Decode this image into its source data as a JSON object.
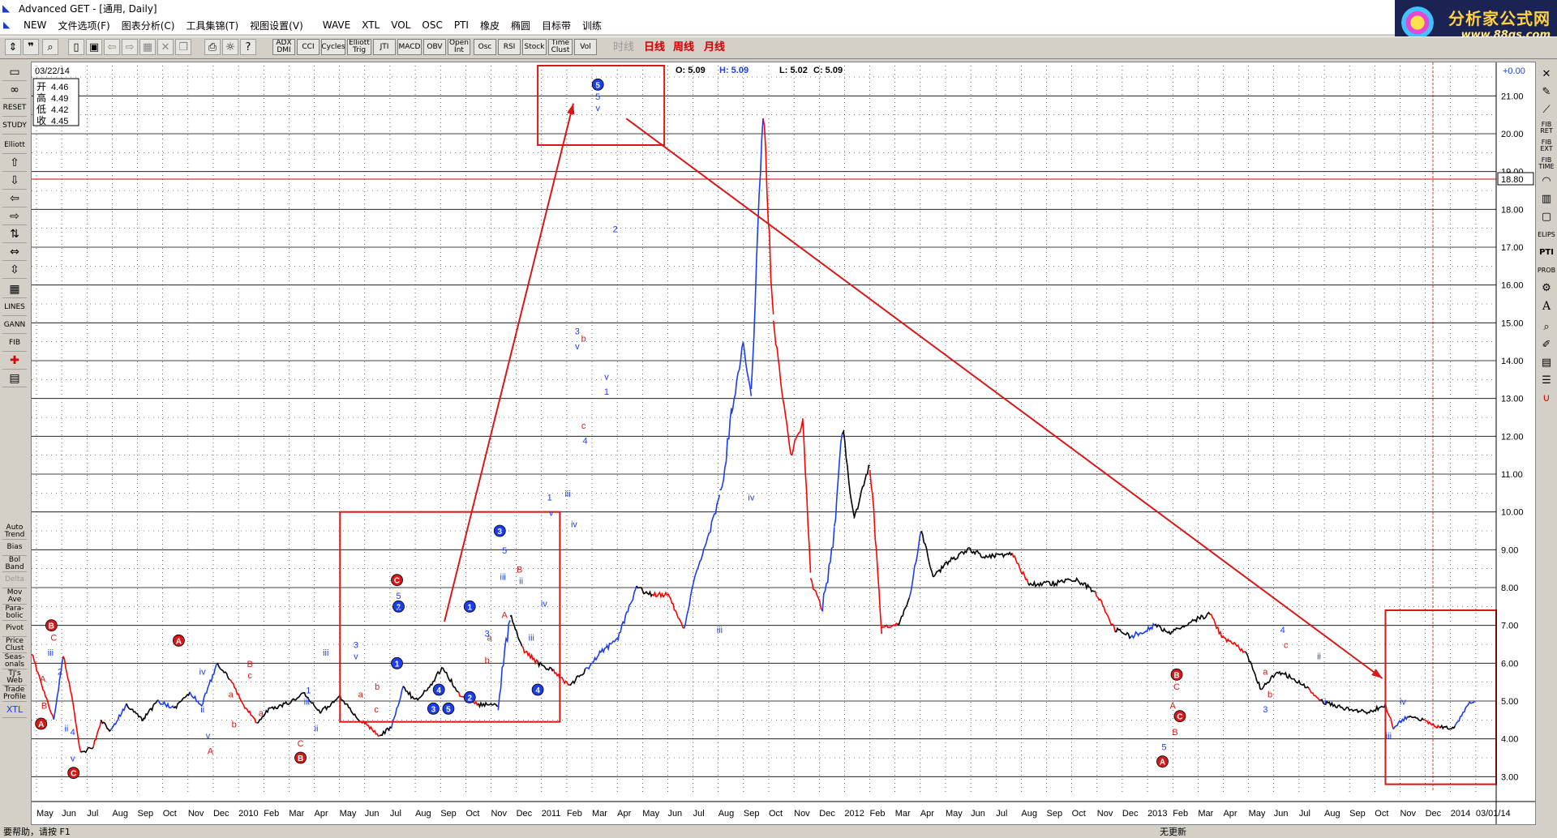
{
  "window": {
    "title": "Advanced GET - [通用, Daily]"
  },
  "menu": {
    "items": [
      "NEW",
      "文件选项(F)",
      "图表分析(C)",
      "工具集锦(T)",
      "视图设置(V)",
      "WAVE",
      "XTL",
      "VOL",
      "OSC",
      "PTI",
      "橡皮",
      "椭圆",
      "目标带",
      "训练"
    ]
  },
  "logo": {
    "line1": "分析家公式网",
    "line2": "www.88gs.com"
  },
  "toolbar": {
    "study_buttons": [
      "ADX DMI",
      "CCI",
      "Cycles",
      "Elliott Trig",
      "JTI",
      "MACD",
      "OBV",
      "Open Int",
      "Osc",
      "RSI",
      "Stock",
      "Time Clust",
      "Vol"
    ],
    "timeframes": {
      "intraday": "时线",
      "daily": "日线",
      "weekly": "周线",
      "monthly": "月线"
    }
  },
  "left_toolbar": {
    "labels": [
      "RESET",
      "STUDY",
      "Elliott",
      "LINES",
      "GANN",
      "FIB"
    ],
    "study_labels": [
      "Auto Trend",
      "Bias",
      "Bol Band",
      "Delta",
      "Mov Ave",
      "Para-bolic",
      "Pivot",
      "Price Clust",
      "Seas-onals",
      "TJ's Web",
      "Trade Profile",
      "XTL"
    ]
  },
  "right_toolbar": {
    "labels": [
      "FIB RET",
      "FIB EXT",
      "FIB TIME",
      "ELIPS",
      "PTI",
      "PROB"
    ]
  },
  "chart": {
    "date_label": "03/22/14",
    "ohlc_box": {
      "open_label": "开",
      "open": "4.46",
      "high_label": "高",
      "high": "4.49",
      "low_label": "低",
      "low": "4.42",
      "close_label": "收",
      "close": "4.45"
    },
    "quote": {
      "o": "O: 5.09",
      "h": "H: 5.09",
      "l": "L: 5.02",
      "c": "C: 5.09"
    },
    "change": "+0.00",
    "price_marker": "18.80",
    "price_ticks": [
      "3.00",
      "4.00",
      "5.00",
      "6.00",
      "7.00",
      "8.00",
      "9.00",
      "10.00",
      "11.00",
      "12.00",
      "13.00",
      "14.00",
      "15.00",
      "16.00",
      "17.00",
      "18.00",
      "19.00",
      "20.00",
      "21.00"
    ],
    "date_ticks": [
      "May",
      "Jun",
      "Jul",
      "Aug",
      "Sep",
      "Oct",
      "Nov",
      "Dec",
      "2010",
      "Feb",
      "Mar",
      "Apr",
      "May",
      "Jun",
      "Jul",
      "Aug",
      "Sep",
      "Oct",
      "Nov",
      "Dec",
      "2011",
      "Feb",
      "Mar",
      "Apr",
      "May",
      "Jun",
      "Jul",
      "Aug",
      "Sep",
      "Oct",
      "Nov",
      "Dec",
      "2012",
      "Feb",
      "Mar",
      "Apr",
      "May",
      "Jun",
      "Jul",
      "Aug",
      "Sep",
      "Oct",
      "Nov",
      "Dec",
      "2013",
      "Feb",
      "Mar",
      "Apr",
      "May",
      "Jun",
      "Jul",
      "Aug",
      "Sep",
      "Oct",
      "Nov",
      "Dec",
      "2014",
      "03/01/14"
    ],
    "colors": {
      "up": "#1b3df0",
      "down": "#ff0000",
      "neutral": "#000000",
      "annotation": "#d81818"
    }
  },
  "chart_data": {
    "type": "line",
    "ylim": [
      2.6,
      21.8
    ],
    "price_path": [
      [
        0,
        6.3,
        "d"
      ],
      [
        16,
        5.2,
        "d"
      ],
      [
        28,
        4.5,
        "d"
      ],
      [
        40,
        6.2,
        "u"
      ],
      [
        52,
        5.0,
        "d"
      ],
      [
        62,
        3.6,
        "d"
      ],
      [
        78,
        3.8,
        "n"
      ],
      [
        88,
        4.5,
        "d"
      ],
      [
        100,
        4.2,
        "n"
      ],
      [
        120,
        4.9,
        "u"
      ],
      [
        140,
        4.5,
        "n"
      ],
      [
        160,
        5.0,
        "n"
      ],
      [
        180,
        4.8,
        "u"
      ],
      [
        200,
        5.2,
        "n"
      ],
      [
        215,
        4.9,
        "u"
      ],
      [
        235,
        6.0,
        "u"
      ],
      [
        250,
        5.6,
        "n"
      ],
      [
        268,
        4.9,
        "d"
      ],
      [
        285,
        4.4,
        "d"
      ],
      [
        300,
        4.8,
        "n"
      ],
      [
        320,
        4.9,
        "n"
      ],
      [
        345,
        5.2,
        "n"
      ],
      [
        365,
        4.7,
        "n"
      ],
      [
        390,
        5.1,
        "n"
      ],
      [
        415,
        4.5,
        "n"
      ],
      [
        440,
        4.1,
        "d"
      ],
      [
        455,
        4.3,
        "n"
      ],
      [
        470,
        5.4,
        "u"
      ],
      [
        485,
        5.0,
        "n"
      ],
      [
        500,
        5.3,
        "n"
      ],
      [
        520,
        5.9,
        "n"
      ],
      [
        540,
        5.2,
        "n"
      ],
      [
        565,
        4.9,
        "d"
      ],
      [
        590,
        4.9,
        "n"
      ],
      [
        605,
        7.3,
        "u"
      ],
      [
        620,
        6.4,
        "n"
      ],
      [
        640,
        6.0,
        "d"
      ],
      [
        660,
        5.8,
        "n"
      ],
      [
        680,
        5.4,
        "d"
      ],
      [
        700,
        5.8,
        "n"
      ],
      [
        720,
        6.3,
        "u"
      ],
      [
        740,
        6.6,
        "u"
      ],
      [
        765,
        8.0,
        "u"
      ],
      [
        785,
        7.8,
        "n"
      ],
      [
        805,
        7.8,
        "d"
      ],
      [
        825,
        6.9,
        "d"
      ],
      [
        840,
        8.4,
        "u"
      ],
      [
        855,
        9.3,
        "u"
      ],
      [
        870,
        10.4,
        "u"
      ],
      [
        885,
        12.5,
        "u"
      ],
      [
        900,
        14.5,
        "u"
      ],
      [
        910,
        13.0,
        "u"
      ],
      [
        925,
        20.6,
        "u"
      ],
      [
        938,
        15.0,
        "d"
      ],
      [
        950,
        13.0,
        "d"
      ],
      [
        960,
        11.5,
        "d"
      ],
      [
        975,
        12.4,
        "d"
      ],
      [
        985,
        8.2,
        "d"
      ],
      [
        1000,
        7.4,
        "d"
      ],
      [
        1015,
        9.5,
        "u"
      ],
      [
        1025,
        12.2,
        "u"
      ],
      [
        1040,
        9.8,
        "n"
      ],
      [
        1060,
        11.3,
        "n"
      ],
      [
        1075,
        7.0,
        "d"
      ],
      [
        1095,
        7.0,
        "d"
      ],
      [
        1110,
        7.7,
        "n"
      ],
      [
        1125,
        9.5,
        "u"
      ],
      [
        1140,
        8.3,
        "n"
      ],
      [
        1160,
        8.7,
        "n"
      ],
      [
        1185,
        9.0,
        "n"
      ],
      [
        1210,
        8.8,
        "n"
      ],
      [
        1240,
        8.9,
        "n"
      ],
      [
        1260,
        8.1,
        "d"
      ],
      [
        1290,
        8.1,
        "n"
      ],
      [
        1320,
        8.2,
        "n"
      ],
      [
        1345,
        7.9,
        "n"
      ],
      [
        1370,
        6.9,
        "d"
      ],
      [
        1390,
        6.7,
        "n"
      ],
      [
        1420,
        7.0,
        "u"
      ],
      [
        1440,
        6.8,
        "n"
      ],
      [
        1465,
        7.1,
        "n"
      ],
      [
        1490,
        7.3,
        "n"
      ],
      [
        1505,
        6.7,
        "d"
      ],
      [
        1535,
        6.3,
        "d"
      ],
      [
        1555,
        5.3,
        "n"
      ],
      [
        1575,
        5.8,
        "n"
      ],
      [
        1595,
        5.6,
        "n"
      ],
      [
        1615,
        5.3,
        "n"
      ],
      [
        1630,
        5.0,
        "d"
      ],
      [
        1660,
        4.8,
        "n"
      ],
      [
        1690,
        4.7,
        "n"
      ],
      [
        1712,
        4.9,
        "n"
      ],
      [
        1722,
        4.3,
        "d"
      ],
      [
        1740,
        4.6,
        "u"
      ],
      [
        1760,
        4.5,
        "n"
      ],
      [
        1780,
        4.3,
        "d"
      ],
      [
        1800,
        4.3,
        "n"
      ],
      [
        1815,
        4.9,
        "u"
      ],
      [
        1825,
        5.0,
        "u"
      ]
    ],
    "annotation_boxes": [
      {
        "x0": 390,
        "y0": 10.0,
        "x1": 668,
        "y1": 4.45
      },
      {
        "x0": 640,
        "y0": 21.8,
        "x1": 800,
        "y1": 19.7
      },
      {
        "x0": 1712,
        "y0": 7.4,
        "x1": 1852,
        "y1": 2.8
      }
    ],
    "annotation_arrows": [
      {
        "x0": 522,
        "y0": 7.1,
        "x1": 685,
        "y1": 20.8
      },
      {
        "x0": 752,
        "y0": 20.4,
        "x1": 1708,
        "y1": 5.6
      }
    ],
    "wave_circles": [
      {
        "x": 12,
        "y": 4.4,
        "t": "A",
        "c": "r"
      },
      {
        "x": 25,
        "y": 7.0,
        "t": "B",
        "c": "r"
      },
      {
        "x": 53,
        "y": 3.1,
        "t": "C",
        "c": "r"
      },
      {
        "x": 186,
        "y": 6.6,
        "t": "A",
        "c": "r"
      },
      {
        "x": 340,
        "y": 3.5,
        "t": "B",
        "c": "r"
      },
      {
        "x": 462,
        "y": 8.2,
        "t": "C",
        "c": "r"
      },
      {
        "x": 464,
        "y": 7.5,
        "t": "2",
        "c": "b"
      },
      {
        "x": 462,
        "y": 6.0,
        "t": "1",
        "c": "b"
      },
      {
        "x": 515,
        "y": 5.3,
        "t": "4",
        "c": "b"
      },
      {
        "x": 508,
        "y": 4.8,
        "t": "3",
        "c": "b"
      },
      {
        "x": 527,
        "y": 4.8,
        "t": "5",
        "c": "b"
      },
      {
        "x": 554,
        "y": 7.5,
        "t": "1",
        "c": "b"
      },
      {
        "x": 554,
        "y": 5.1,
        "t": "2",
        "c": "b"
      },
      {
        "x": 592,
        "y": 9.5,
        "t": "3",
        "c": "b"
      },
      {
        "x": 640,
        "y": 5.3,
        "t": "4",
        "c": "b"
      },
      {
        "x": 716,
        "y": 21.3,
        "t": "5",
        "c": "b"
      },
      {
        "x": 1448,
        "y": 5.7,
        "t": "B",
        "c": "r"
      },
      {
        "x": 1452,
        "y": 4.6,
        "t": "C",
        "c": "r"
      },
      {
        "x": 1430,
        "y": 3.4,
        "t": "A",
        "c": "r"
      }
    ],
    "wave_labels": [
      {
        "x": 14,
        "y": 5.5,
        "t": "A",
        "c": "r"
      },
      {
        "x": 16,
        "y": 4.8,
        "t": "B",
        "c": "r"
      },
      {
        "x": 28,
        "y": 6.6,
        "t": "C",
        "c": "r"
      },
      {
        "x": 24,
        "y": 6.2,
        "t": "iii",
        "c": "b"
      },
      {
        "x": 36,
        "y": 5.7,
        "t": "2",
        "c": "b"
      },
      {
        "x": 44,
        "y": 4.2,
        "t": "ii",
        "c": "b"
      },
      {
        "x": 52,
        "y": 4.1,
        "t": "4",
        "c": "b"
      },
      {
        "x": 52,
        "y": 3.4,
        "t": "v",
        "c": "b"
      },
      {
        "x": 216,
        "y": 5.7,
        "t": "iv",
        "c": "b"
      },
      {
        "x": 223,
        "y": 4.0,
        "t": "v",
        "c": "b"
      },
      {
        "x": 226,
        "y": 3.6,
        "t": "A",
        "c": "r"
      },
      {
        "x": 216,
        "y": 4.7,
        "t": "ii",
        "c": "b"
      },
      {
        "x": 252,
        "y": 5.1,
        "t": "a",
        "c": "r"
      },
      {
        "x": 256,
        "y": 4.3,
        "t": "b",
        "c": "r"
      },
      {
        "x": 276,
        "y": 5.9,
        "t": "B",
        "c": "r"
      },
      {
        "x": 276,
        "y": 5.6,
        "t": "c",
        "c": "r"
      },
      {
        "x": 290,
        "y": 4.6,
        "t": "a",
        "c": "r"
      },
      {
        "x": 340,
        "y": 3.8,
        "t": "C",
        "c": "r"
      },
      {
        "x": 350,
        "y": 5.2,
        "t": "1",
        "c": "b"
      },
      {
        "x": 348,
        "y": 4.9,
        "t": "iii",
        "c": "b"
      },
      {
        "x": 372,
        "y": 6.2,
        "t": "iii",
        "c": "b"
      },
      {
        "x": 360,
        "y": 4.2,
        "t": "ii",
        "c": "b"
      },
      {
        "x": 410,
        "y": 6.4,
        "t": "3",
        "c": "b"
      },
      {
        "x": 410,
        "y": 6.1,
        "t": "v",
        "c": "b"
      },
      {
        "x": 416,
        "y": 5.1,
        "t": "a",
        "c": "r"
      },
      {
        "x": 437,
        "y": 5.3,
        "t": "b",
        "c": "r"
      },
      {
        "x": 436,
        "y": 4.7,
        "t": "c",
        "c": "r"
      },
      {
        "x": 464,
        "y": 7.7,
        "t": "5",
        "c": "b"
      },
      {
        "x": 464,
        "y": 7.4,
        "t": "v",
        "c": "b"
      },
      {
        "x": 576,
        "y": 6.7,
        "t": "3",
        "c": "b"
      },
      {
        "x": 576,
        "y": 6.0,
        "t": "b",
        "c": "r"
      },
      {
        "x": 579,
        "y": 6.6,
        "t": "a",
        "c": "r"
      },
      {
        "x": 598,
        "y": 8.9,
        "t": "5",
        "c": "b"
      },
      {
        "x": 596,
        "y": 8.2,
        "t": "iii",
        "c": "b"
      },
      {
        "x": 598,
        "y": 7.2,
        "t": "A",
        "c": "r"
      },
      {
        "x": 617,
        "y": 8.4,
        "t": "B",
        "c": "r"
      },
      {
        "x": 619,
        "y": 8.1,
        "t": "ii",
        "c": "b"
      },
      {
        "x": 648,
        "y": 7.5,
        "t": "iv",
        "c": "b"
      },
      {
        "x": 632,
        "y": 6.6,
        "t": "iii",
        "c": "b"
      },
      {
        "x": 655,
        "y": 10.3,
        "t": "1",
        "c": "b"
      },
      {
        "x": 657,
        "y": 9.9,
        "t": "v",
        "c": "b"
      },
      {
        "x": 678,
        "y": 10.4,
        "t": "iii",
        "c": "b"
      },
      {
        "x": 686,
        "y": 9.6,
        "t": "iv",
        "c": "b"
      },
      {
        "x": 690,
        "y": 14.7,
        "t": "3",
        "c": "b"
      },
      {
        "x": 690,
        "y": 14.3,
        "t": "v",
        "c": "b"
      },
      {
        "x": 698,
        "y": 14.5,
        "t": "b",
        "c": "r"
      },
      {
        "x": 698,
        "y": 12.2,
        "t": "c",
        "c": "r"
      },
      {
        "x": 700,
        "y": 11.8,
        "t": "4",
        "c": "b"
      },
      {
        "x": 716,
        "y": 20.9,
        "t": "5",
        "c": "b"
      },
      {
        "x": 716,
        "y": 20.6,
        "t": "v",
        "c": "b"
      },
      {
        "x": 738,
        "y": 17.4,
        "t": "2",
        "c": "b"
      },
      {
        "x": 727,
        "y": 13.1,
        "t": "1",
        "c": "b"
      },
      {
        "x": 727,
        "y": 13.5,
        "t": "v",
        "c": "b"
      },
      {
        "x": 910,
        "y": 10.3,
        "t": "iv",
        "c": "b"
      },
      {
        "x": 870,
        "y": 6.8,
        "t": "iii",
        "c": "b"
      },
      {
        "x": 1582,
        "y": 6.8,
        "t": "4",
        "c": "b"
      },
      {
        "x": 1586,
        "y": 6.4,
        "t": "c",
        "c": "r"
      },
      {
        "x": 1560,
        "y": 5.7,
        "t": "a",
        "c": "r"
      },
      {
        "x": 1566,
        "y": 5.1,
        "t": "b",
        "c": "r"
      },
      {
        "x": 1560,
        "y": 4.7,
        "t": "3",
        "c": "b"
      },
      {
        "x": 1628,
        "y": 6.1,
        "t": "ii",
        "c": "b"
      },
      {
        "x": 1636,
        "y": 4.9,
        "t": "i",
        "c": "b"
      },
      {
        "x": 1734,
        "y": 4.9,
        "t": "iv",
        "c": "b"
      },
      {
        "x": 1716,
        "y": 4.0,
        "t": "iii",
        "c": "b"
      },
      {
        "x": 1443,
        "y": 4.8,
        "t": "A",
        "c": "r"
      },
      {
        "x": 1446,
        "y": 4.1,
        "t": "B",
        "c": "r"
      },
      {
        "x": 1448,
        "y": 5.3,
        "t": "C",
        "c": "r"
      },
      {
        "x": 1432,
        "y": 3.7,
        "t": "5",
        "c": "b"
      }
    ]
  },
  "statusbar": {
    "left": "要帮助，请按 F1",
    "right": "无更新"
  }
}
